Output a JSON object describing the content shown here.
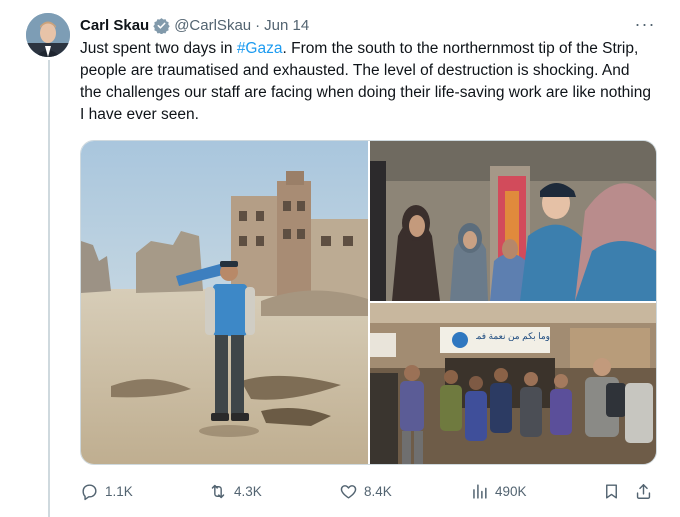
{
  "tweet": {
    "author_name": "Carl Skau",
    "handle": "@CarlSkau",
    "separator": "·",
    "date": "Jun 14",
    "text_before_hashtag": "Just spent two days in ",
    "hashtag": "#Gaza",
    "text_after_hashtag": ". From the south to the northernmost tip of the Strip, people are traumatised and exhausted. The level of destruction is shocking. And the challenges our staff are facing when doing their life-saving work are like nothing I have ever seen.",
    "more_label": "···"
  },
  "actions": {
    "replies": "1.1K",
    "reposts": "4.3K",
    "likes": "8.4K",
    "views": "490K"
  },
  "media": {
    "sign_text": "وما بكم من نعمة فمن الله"
  },
  "colors": {
    "text": "#0f1419",
    "muted": "#536471",
    "link": "#1d9bf0",
    "border": "#cfd9de",
    "verified_badge": "#829aab"
  }
}
